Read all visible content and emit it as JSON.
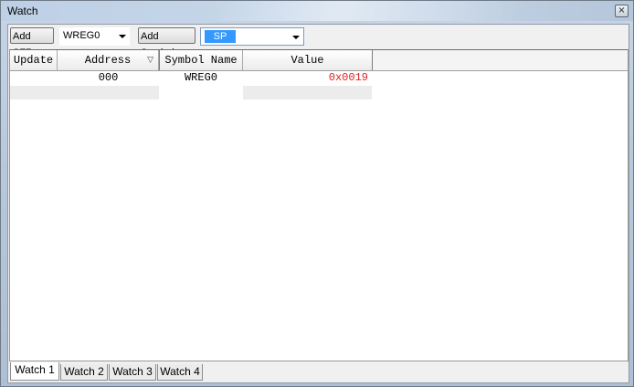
{
  "window": {
    "title": "Watch",
    "close_glyph": "×"
  },
  "toolbar": {
    "add_sfr_label": "Add SFR",
    "sfr_selected": "WREG0",
    "add_symbol_label": "Add Symbol",
    "symbol_selected": "SP"
  },
  "grid": {
    "columns": [
      "Update",
      "Address",
      "Symbol Name",
      "Value"
    ],
    "rows": [
      {
        "update": "",
        "address": "000",
        "symbol": "WREG0",
        "value": "0x0019"
      }
    ],
    "value_color": "#e02020"
  },
  "tabs": [
    "Watch 1",
    "Watch 2",
    "Watch 3",
    "Watch 4"
  ],
  "active_tab": "Watch 1",
  "colors": {
    "selection": "#3399ff",
    "changed_value": "#e02020"
  }
}
